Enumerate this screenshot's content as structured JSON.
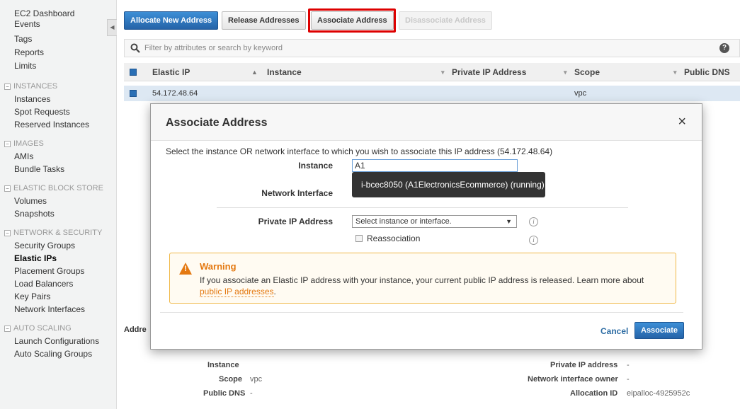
{
  "sidebar": {
    "top_items": [
      "EC2 Dashboard",
      "Events",
      "Tags",
      "Reports",
      "Limits"
    ],
    "sections": [
      {
        "title": "INSTANCES",
        "items": [
          "Instances",
          "Spot Requests",
          "Reserved Instances"
        ]
      },
      {
        "title": "IMAGES",
        "items": [
          "AMIs",
          "Bundle Tasks"
        ]
      },
      {
        "title": "ELASTIC BLOCK STORE",
        "items": [
          "Volumes",
          "Snapshots"
        ]
      },
      {
        "title": "NETWORK & SECURITY",
        "items": [
          "Security Groups",
          "Elastic IPs",
          "Placement Groups",
          "Load Balancers",
          "Key Pairs",
          "Network Interfaces"
        ]
      },
      {
        "title": "AUTO SCALING",
        "items": [
          "Launch Configurations",
          "Auto Scaling Groups"
        ]
      }
    ],
    "active_item": "Elastic IPs"
  },
  "toolbar": {
    "allocate": "Allocate New Address",
    "release": "Release Addresses",
    "associate": "Associate Address",
    "disassociate": "Disassociate Address"
  },
  "filter": {
    "placeholder": "Filter by attributes or search by keyword",
    "help": "?"
  },
  "table": {
    "columns": [
      "Elastic IP",
      "Instance",
      "Private IP Address",
      "Scope",
      "Public DNS"
    ],
    "rows": [
      {
        "elastic_ip": "54.172.48.64",
        "instance": "",
        "private_ip": "",
        "scope": "vpc",
        "public_dns": ""
      }
    ]
  },
  "details": {
    "tab_label": "Addre",
    "instance_label": "Instance",
    "scope_label": "Scope",
    "scope_value": "vpc",
    "public_dns_label": "Public DNS",
    "public_dns_value": "-",
    "private_ip_label": "Private IP address",
    "private_ip_value": "-",
    "nio_label": "Network interface owner",
    "nio_value": "-",
    "allocation_label": "Allocation ID",
    "allocation_value": "eipalloc-4925952c"
  },
  "modal": {
    "title": "Associate Address",
    "close": "×",
    "instruction": "Select the instance OR network interface to which you wish to associate this IP address (54.172.48.64)",
    "instance_label": "Instance",
    "instance_value": "A1",
    "suggestion": "i-bcec8050 (A1ElectronicsEcommerce) (running)",
    "network_interface_label": "Network Interface",
    "private_ip_label": "Private IP Address",
    "private_ip_select": "Select instance or interface.",
    "reassociation_label": "Reassociation",
    "info_glyph": "i",
    "warning": {
      "title": "Warning",
      "text": "If you associate an Elastic IP address with your instance, your current public IP address is released. Learn more about ",
      "link": "public IP addresses",
      "period": "."
    },
    "cancel": "Cancel",
    "associate": "Associate"
  },
  "colors": {
    "primary_blue": "#2e6da4",
    "warning_orange": "#e47911",
    "highlight_red": "#dd0000"
  }
}
